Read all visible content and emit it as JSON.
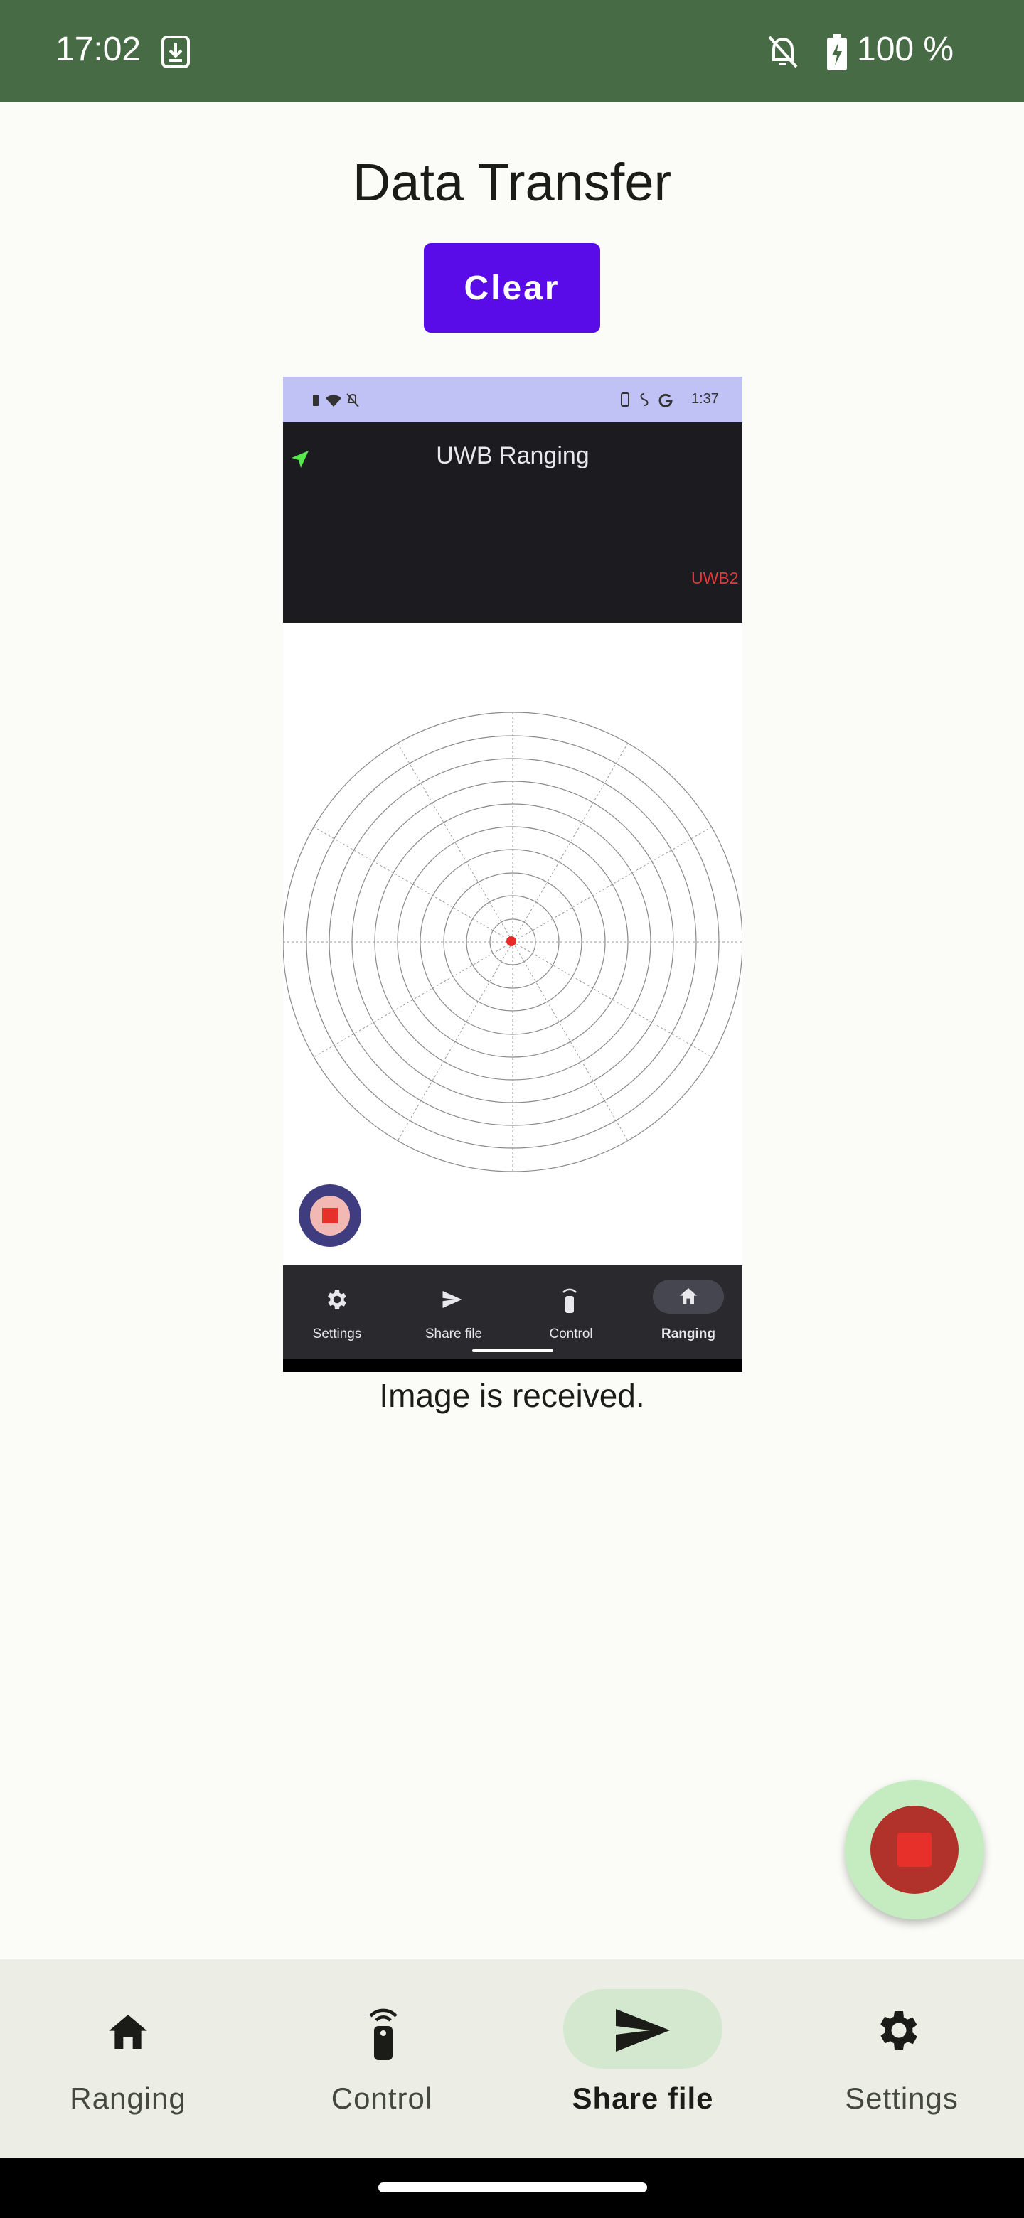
{
  "status_bar": {
    "time": "17:02",
    "battery": "100 %"
  },
  "page": {
    "title": "Data Transfer",
    "clear_label": "Clear",
    "message": "Image is received."
  },
  "received_image": {
    "status_time": "1:37",
    "title": "UWB Ranging",
    "device_label": "UWB2",
    "nav": [
      "Settings",
      "Share file",
      "Control",
      "Ranging"
    ]
  },
  "bottom_nav": {
    "items": [
      {
        "label": "Ranging",
        "icon": "home-icon"
      },
      {
        "label": "Control",
        "icon": "remote-icon"
      },
      {
        "label": "Share file",
        "icon": "send-icon"
      },
      {
        "label": "Settings",
        "icon": "gear-icon"
      }
    ],
    "selected": "Share file"
  },
  "colors": {
    "accent": "#5a0ce8",
    "status_bar": "#476b45",
    "fab": "#c4ecc0",
    "stop": "#e8302a"
  }
}
